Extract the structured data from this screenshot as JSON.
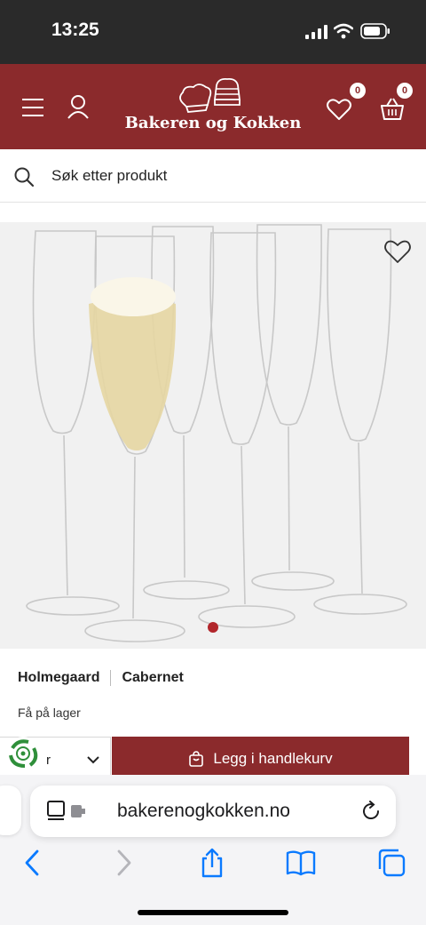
{
  "status_bar": {
    "time": "13:25"
  },
  "header": {
    "logo_text": "Bakeren og Kokken",
    "wishlist_count": "0",
    "cart_count": "0",
    "brand_color": "#8b2a2c"
  },
  "search": {
    "placeholder": "Søk etter produkt"
  },
  "product": {
    "brand": "Holmegaard",
    "series": "Cabernet",
    "stock_status": "Få på lager",
    "quantity_value": "r",
    "add_to_cart_label": "Legg i handlekurv"
  },
  "browser": {
    "url": "bakerenogkokken.no"
  },
  "icons": [
    "menu-icon",
    "account-icon",
    "heart-icon",
    "basket-icon",
    "search-icon",
    "heart-outline-icon",
    "chevron-down-icon",
    "recycle-icon",
    "bag-icon",
    "reader-icon",
    "reload-icon",
    "back-icon",
    "forward-icon",
    "share-icon",
    "bookmarks-icon",
    "tabs-icon"
  ]
}
